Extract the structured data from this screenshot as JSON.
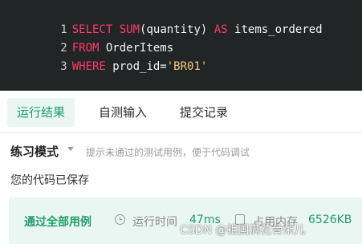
{
  "editor": {
    "lines": [
      {
        "number": "1",
        "tokens": [
          {
            "text": "SELECT ",
            "type": "kw"
          },
          {
            "text": "SUM",
            "type": "kw"
          },
          {
            "text": "(quantity) ",
            "type": "plain"
          },
          {
            "text": "AS",
            "type": "kw"
          },
          {
            "text": " items_ordered",
            "type": "plain"
          }
        ]
      },
      {
        "number": "2",
        "tokens": [
          {
            "text": "FROM",
            "type": "kw"
          },
          {
            "text": " OrderItems",
            "type": "plain"
          }
        ]
      },
      {
        "number": "3",
        "tokens": [
          {
            "text": "WHERE",
            "type": "kw"
          },
          {
            "text": " prod_id=",
            "type": "plain"
          },
          {
            "text": "'BR01'",
            "type": "str"
          }
        ]
      }
    ]
  },
  "tabs": [
    {
      "label": "运行结果",
      "active": true
    },
    {
      "label": "自测输入",
      "active": false
    },
    {
      "label": "提交记录",
      "active": false
    }
  ],
  "mode": {
    "title": "练习模式",
    "hint": "提示未通过的测试用例，便于代码调试"
  },
  "status": {
    "saved": "您的代码已保存"
  },
  "result": {
    "pass_label": "通过全部用例",
    "runtime_label": "运行时间",
    "runtime_value": "47ms",
    "memory_label": "占用内存",
    "memory_value": "6526KB"
  },
  "watermark": "CSDN @祖国满花骨朵儿",
  "colors": {
    "accent": "#1f9d6a",
    "editor_bg": "#222526",
    "keyword": "#ff3b6b",
    "string": "#f4c97a"
  },
  "icons": {
    "runtime": "clock-icon",
    "memory": "memory-icon",
    "mode": "chevron-down-icon"
  }
}
